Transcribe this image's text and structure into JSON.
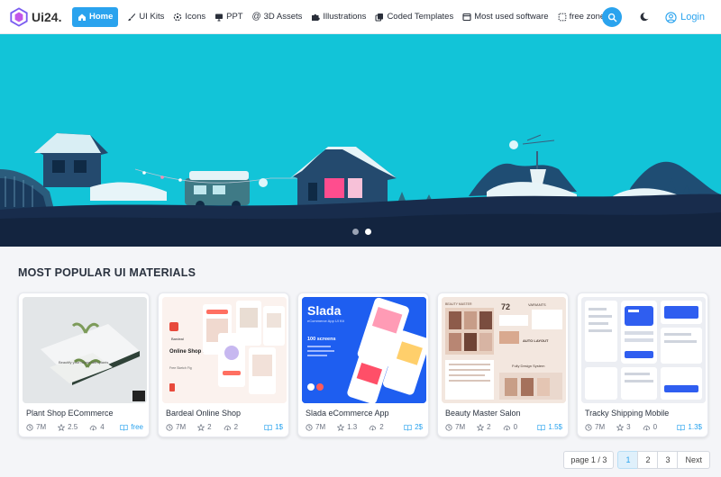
{
  "brand": {
    "name": "Ui24."
  },
  "nav": {
    "items": [
      {
        "label": "Home",
        "icon": "home-icon",
        "active": true
      },
      {
        "label": "UI Kits",
        "icon": "brush-icon"
      },
      {
        "label": "Icons",
        "icon": "target-icon"
      },
      {
        "label": "PPT",
        "icon": "presentation-icon"
      },
      {
        "label": "3D Assets",
        "icon": "at-icon"
      },
      {
        "label": "Illustrations",
        "icon": "puzzle-icon"
      },
      {
        "label": "Coded Templates",
        "icon": "copy-icon"
      },
      {
        "label": "Most used software",
        "icon": "window-icon"
      },
      {
        "label": "free zone",
        "icon": "dotted-square-icon"
      }
    ],
    "login_label": "Login"
  },
  "hero": {
    "slides": 2,
    "active_slide": 2
  },
  "section": {
    "title": "MOST POPULAR UI MATERIALS"
  },
  "cards": [
    {
      "title": "Plant Shop ECommerce",
      "views": "7M",
      "rating": "2.5",
      "downloads": "4",
      "price": "free"
    },
    {
      "title": "Bardeal Online Shop",
      "views": "7M",
      "rating": "2",
      "downloads": "2",
      "price": "1$"
    },
    {
      "title": "Slada eCommerce App",
      "views": "7M",
      "rating": "1.3",
      "downloads": "2",
      "price": "2$"
    },
    {
      "title": "Beauty Master Salon",
      "views": "7M",
      "rating": "2",
      "downloads": "0",
      "price": "1.5$"
    },
    {
      "title": "Tracky Shipping Mobile",
      "views": "7M",
      "rating": "3",
      "downloads": "0",
      "price": "1.3$"
    }
  ],
  "thumb_text": {
    "bardeal": "Online Shop App UI Kit",
    "bardeal_brand": "Bardeal",
    "bardeal_small": "Free Sketch Fig",
    "slada_name": "Slada",
    "slada_sub": "eCommerce App UI Kit",
    "slada_screens": "100 screens",
    "beauty_header": "BEAUTY MASTER",
    "beauty_num": "72",
    "beauty_variants": "VARIANTS",
    "beauty_auto": "AUTO LAYOUT",
    "beauty_design": "Fully Design System",
    "plant_text": "Beautify your house with plants"
  },
  "pager": {
    "info": "page 1 / 3",
    "pages": [
      "1",
      "2",
      "3"
    ],
    "active": "1",
    "next_label": "Next"
  },
  "colors": {
    "accent": "#2aa3ee",
    "hero_sky": "#12c4d8",
    "ground": "#182c4c"
  }
}
